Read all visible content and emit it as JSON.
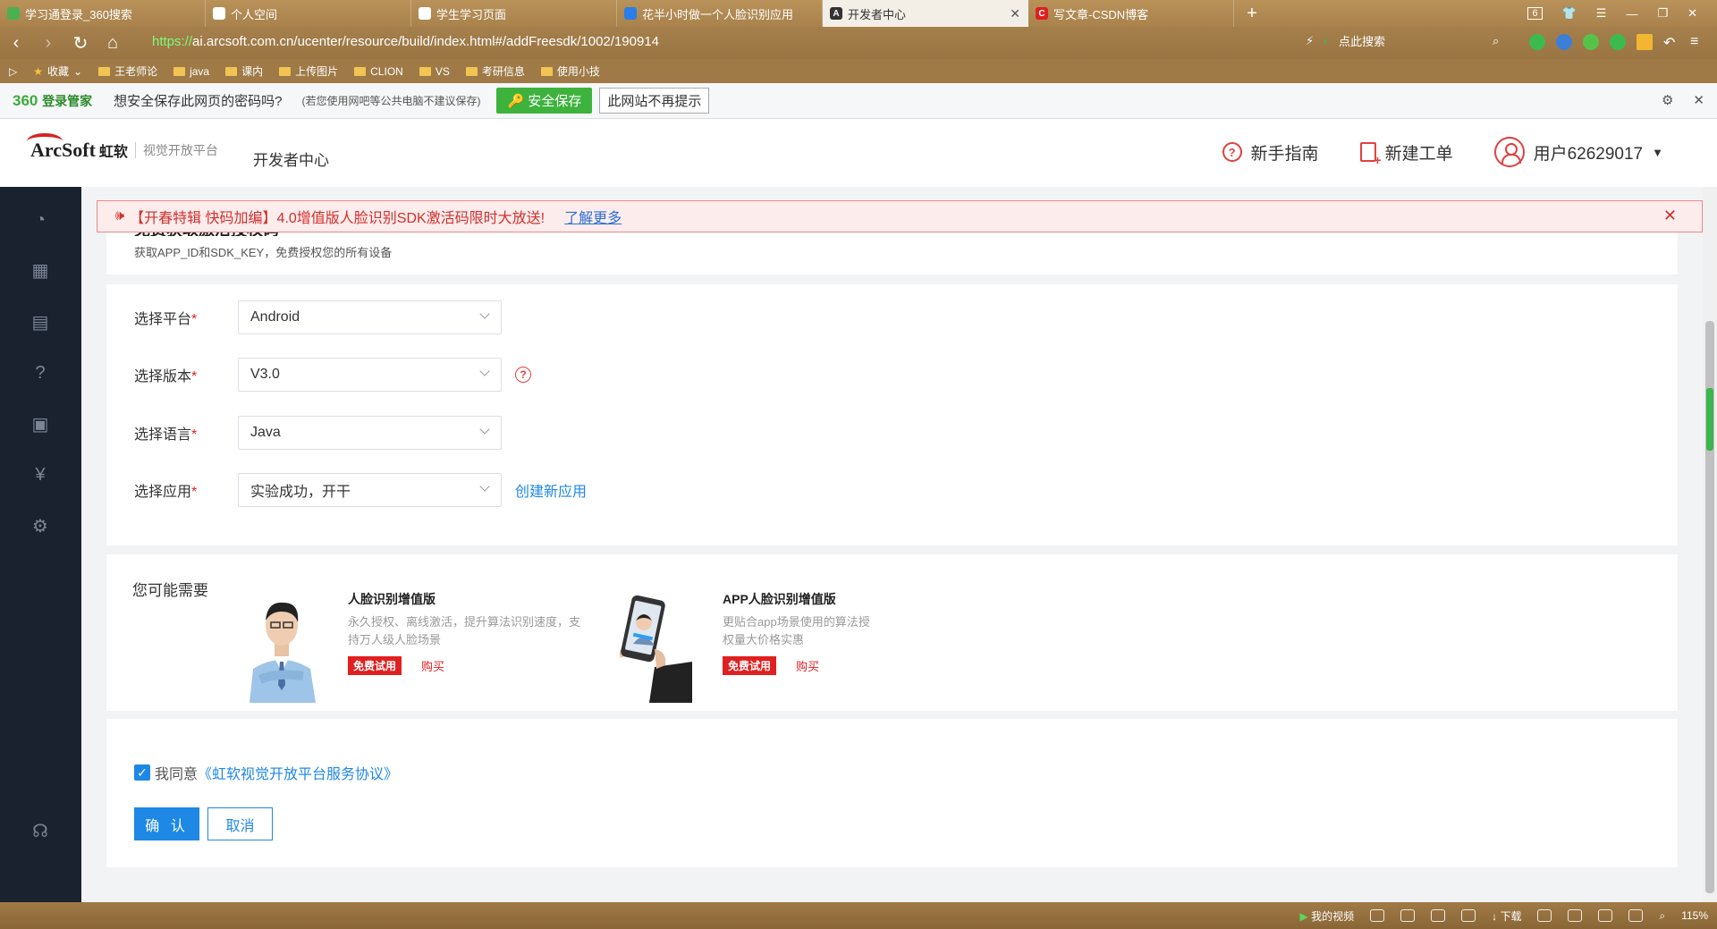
{
  "browser": {
    "tabs": [
      {
        "title": "学习通登录_360搜索",
        "icon_color": "#4caf50"
      },
      {
        "title": "个人空间",
        "icon_color": "#ffffff"
      },
      {
        "title": "学生学习页面",
        "icon_color": "#ffffff"
      },
      {
        "title": "花半小时做一个人脸识别应用",
        "icon_color": "#2b7de9"
      },
      {
        "title": "开发者中心",
        "icon_color": "#333333"
      },
      {
        "title": "写文章-CSDN博客",
        "icon_color": "#e02020"
      }
    ],
    "tab_count": "6",
    "url_scheme": "https://",
    "url_rest": "ai.arcsoft.com.cn/ucenter/resource/build/index.html#/addFreesdk/1002/190914",
    "search_label": "点此搜索",
    "bookmarks": [
      "收藏",
      "王老师论",
      "java",
      "课内",
      "上传图片",
      "CLION",
      "VS",
      "考研信息",
      "使用小技"
    ],
    "password_bar": {
      "logo": "360",
      "logo_sub": "登录管家",
      "prompt": "想安全保存此网页的密码吗?",
      "note": "(若您使用网吧等公共电脑不建议保存)",
      "save": "安全保存",
      "never": "此网站不再提示"
    },
    "status": {
      "video": "我的视频",
      "download": "下载",
      "zoom": "115%"
    }
  },
  "header": {
    "brand": "ArcSoft",
    "brand_cn": "虹软",
    "platform": "视觉开放平台",
    "dev_center": "开发者中心",
    "guide": "新手指南",
    "ticket": "新建工单",
    "user": "用户62629017"
  },
  "notice": {
    "text": "【开春特辑 快码加编】4.0增值版人脸识别SDK激活码限时大放送!",
    "link": "了解更多"
  },
  "section": {
    "title_cut": "免费获取激活授权码",
    "subtitle": "获取APP_ID和SDK_KEY，免费授权您的所有设备"
  },
  "form": {
    "platform_label": "选择平台",
    "platform_value": "Android",
    "version_label": "选择版本",
    "version_value": "V3.0",
    "language_label": "选择语言",
    "language_value": "Java",
    "app_label": "选择应用",
    "app_value": "实验成功，开干",
    "create_app": "创建新应用",
    "required_mark": "*"
  },
  "recommend": {
    "title": "您可能需要",
    "products": [
      {
        "name": "人脸识别增值版",
        "desc": "永久授权、离线激活，提升算法识别速度，支持万人级人脸场景",
        "try": "免费试用",
        "buy": "购买"
      },
      {
        "name": "APP人脸识别增值版",
        "desc": "更贴合app场景使用的算法授权量大价格实惠",
        "try": "免费试用",
        "buy": "购买"
      }
    ]
  },
  "confirm": {
    "agree_prefix": "我同意",
    "agreement": "《虹软视觉开放平台服务协议》",
    "ok": "确 认",
    "cancel": "取消"
  }
}
